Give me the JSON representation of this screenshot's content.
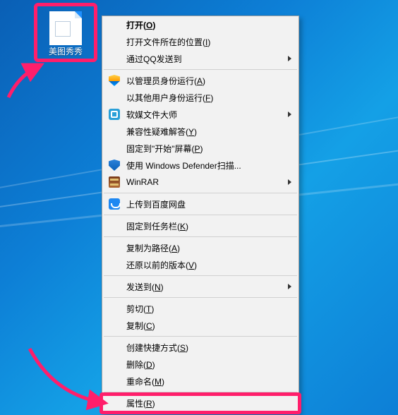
{
  "desktop_icon": {
    "label": "美图秀秀"
  },
  "menu": {
    "open": {
      "text": "打开(",
      "hotkey": "O",
      "tail": ")"
    },
    "open_location": {
      "text": "打开文件所在的位置(",
      "hotkey": "I",
      "tail": ")"
    },
    "qq_send": {
      "text": "通过QQ发送到"
    },
    "run_admin": {
      "text": "以管理员身份运行(",
      "hotkey": "A",
      "tail": ")"
    },
    "run_as_user": {
      "text": "以其他用户身份运行(",
      "hotkey": "F",
      "tail": ")"
    },
    "ruanmei": {
      "text": "软媒文件大师"
    },
    "compat": {
      "text": "兼容性疑难解答(",
      "hotkey": "Y",
      "tail": ")"
    },
    "pin_start": {
      "text": "固定到\"开始\"屏幕(",
      "hotkey": "P",
      "tail": ")"
    },
    "defender": {
      "text": "使用 Windows Defender扫描..."
    },
    "winrar": {
      "text": "WinRAR"
    },
    "baidu": {
      "text": "上传到百度网盘"
    },
    "pin_taskbar": {
      "text": "固定到任务栏(",
      "hotkey": "K",
      "tail": ")"
    },
    "copy_as_path": {
      "text": "复制为路径(",
      "hotkey": "A",
      "tail": ")"
    },
    "restore_prev": {
      "text": "还原以前的版本(",
      "hotkey": "V",
      "tail": ")"
    },
    "send_to": {
      "text": "发送到(",
      "hotkey": "N",
      "tail": ")"
    },
    "cut": {
      "text": "剪切(",
      "hotkey": "T",
      "tail": ")"
    },
    "copy": {
      "text": "复制(",
      "hotkey": "C",
      "tail": ")"
    },
    "create_shortcut": {
      "text": "创建快捷方式(",
      "hotkey": "S",
      "tail": ")"
    },
    "delete": {
      "text": "删除(",
      "hotkey": "D",
      "tail": ")"
    },
    "rename": {
      "text": "重命名(",
      "hotkey": "M",
      "tail": ")"
    },
    "properties": {
      "text": "属性(",
      "hotkey": "R",
      "tail": ")"
    }
  },
  "highlights": {
    "icon_box_color": "#ff1e6b",
    "properties_box_color": "#ff1e6b"
  }
}
